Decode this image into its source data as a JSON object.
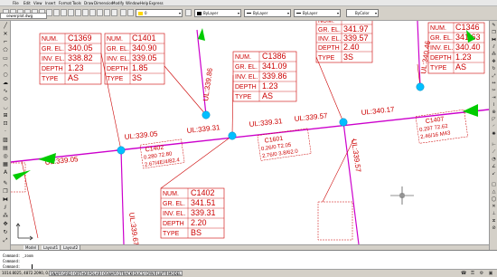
{
  "menu": {
    "items": [
      "File",
      "Edit",
      "View",
      "Insert",
      "Format",
      "Tools",
      "Draw",
      "Dimension",
      "Modify",
      "Window",
      "Help",
      "Express"
    ]
  },
  "toolbar": {
    "file_tab": "sewerplot.dwg",
    "layer_dropdown": "0",
    "color_dropdown": "ByLayer",
    "linetype_dropdown": "ByLayer",
    "lineweight_dropdown": "ByLayer",
    "plotstyle_dropdown": "ByColor"
  },
  "drawing": {
    "manholes": [
      {
        "num": "C1369",
        "gr_el": "340.05",
        "inv_el": "338.82",
        "depth": "1.23",
        "type": "AS"
      },
      {
        "num": "C1401",
        "gr_el": "340.90",
        "inv_el": "339.05",
        "depth": "1.85",
        "type": "3S"
      },
      {
        "num": "C1386",
        "gr_el": "341.09",
        "inv_el": "339.86",
        "depth": "1.23",
        "type": "AS"
      },
      {
        "num": "",
        "gr_el": "341.97",
        "inv_el": "339.57",
        "depth": "2.40",
        "type": "3S"
      },
      {
        "num": "C1346",
        "gr_el": "341.63",
        "inv_el": "340.40",
        "depth": "1.23",
        "type": "AS"
      },
      {
        "num": "C1402",
        "gr_el": "341.51",
        "inv_el": "339.31",
        "depth": "2.20",
        "type": "BS"
      }
    ],
    "field_labels": {
      "num": "NUM.",
      "gr_el": "GR. EL.",
      "inv_el": "INV. EL.",
      "depth": "DEPTH",
      "type": "TYPE"
    },
    "pipe_labels": {
      "h1": "UL:339.05",
      "h2": "UL:339.05",
      "h3": "UL:339.31",
      "h4": "UL:339.31",
      "h5": "UL:339.57",
      "h6": "UL:340.17",
      "v1": "UL:339.86",
      "v2": "UL:340.46",
      "v3": "UL:339.67",
      "v4": "UL:339.57"
    },
    "callouts": {
      "c1": "C1402",
      "c1a": "0.280 72.80",
      "c1b": "2.67/4E/4/82.4",
      "c2": "C1601",
      "c2a": "0.26/0 T2.05",
      "c2b": "2.76/0 3.8/62.0",
      "c3": "C1407",
      "c3a": "0.297 72.62",
      "c3b": "2.46/16 M43"
    }
  },
  "layout_tabs": [
    "Model",
    "Layout1",
    "Layout2"
  ],
  "command": {
    "line1": "Command: _zoom",
    "line2": "Command:",
    "line3": "Command:"
  },
  "status": {
    "coords": "1014.8025, 4872.2090, 0.0000",
    "toggles": [
      "SNAP",
      "GRID",
      "ORTHO",
      "POLAR",
      "OSNAP",
      "OTRACK",
      "DUCS",
      "DYN",
      "LWT",
      "MODEL"
    ]
  },
  "colors": {
    "background": "#ffffff",
    "pipe": "#cc00cc",
    "annotation": "#cc0000",
    "manhole": "#00bfff",
    "arrow": "#00cc00"
  }
}
